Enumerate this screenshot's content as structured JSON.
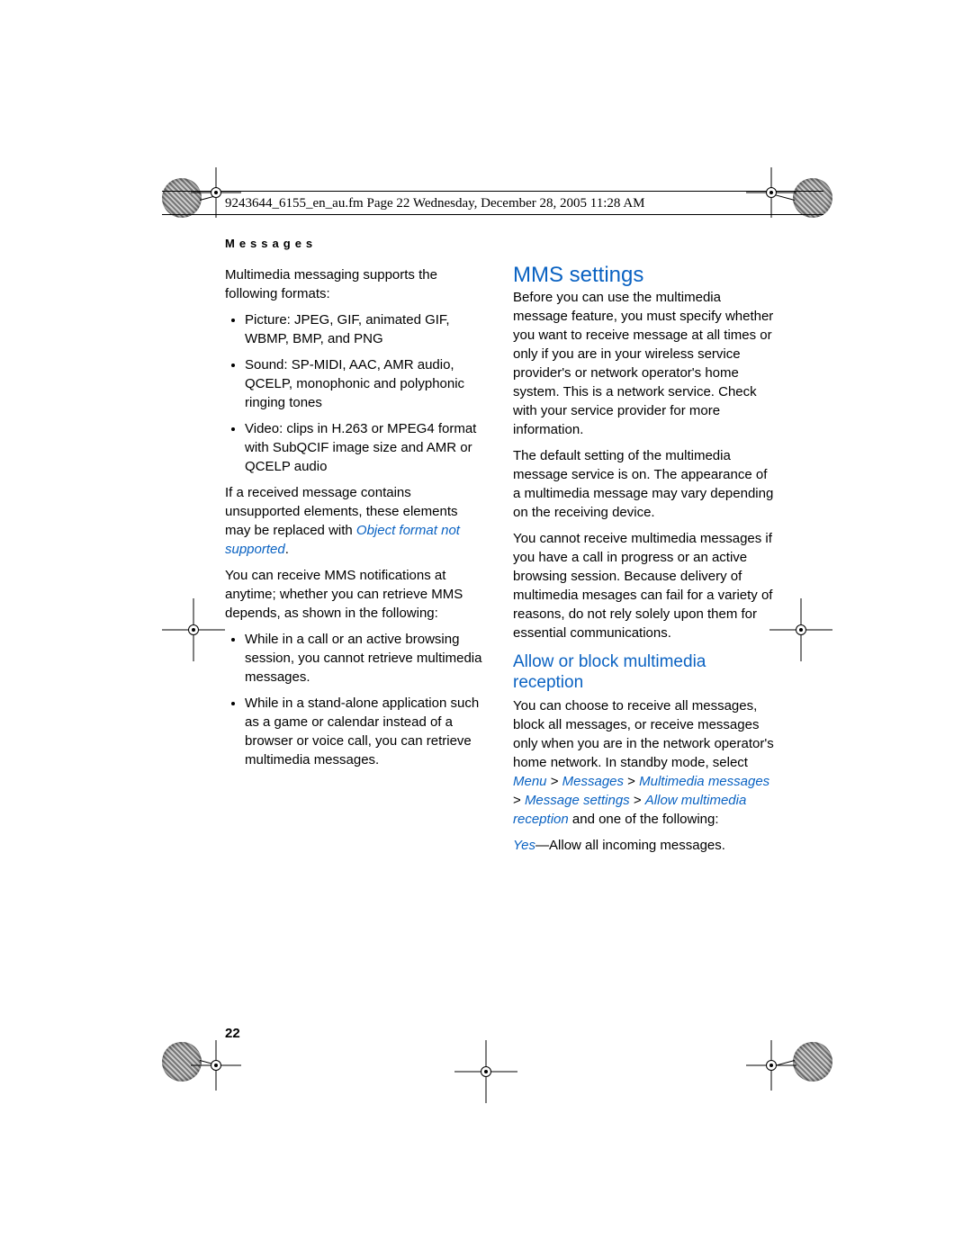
{
  "header": {
    "meta_line": "9243644_6155_en_au.fm  Page 22  Wednesday, December 28, 2005  11:28 AM"
  },
  "section_label": "Messages",
  "page_number": "22",
  "left_col": {
    "intro": "Multimedia messaging supports the following formats:",
    "bullets_1": [
      "Picture: JPEG, GIF, animated GIF, WBMP, BMP, and PNG",
      "Sound: SP-MIDI, AAC, AMR audio, QCELP, monophonic and polyphonic ringing tones",
      "Video: clips in H.263 or MPEG4 format with SubQCIF image size and AMR or QCELP audio"
    ],
    "p2_a": "If a received message contains unsupported elements, these elements may be replaced with ",
    "p2_em": "Object format not supported",
    "p2_b": ".",
    "p3": "You can receive MMS notifications at anytime; whether you can retrieve MMS depends, as shown in the following:",
    "bullets_2": [
      "While in a call or an active browsing session, you cannot retrieve multimedia messages.",
      "While in a stand-alone application such as a game or calendar instead of a browser or voice call, you can retrieve multimedia messages."
    ]
  },
  "right_col": {
    "h2": "MMS settings",
    "p1": "Before you can use the multimedia message feature, you must specify whether you want to receive message at all times or only if you are in your wireless service provider's or network operator's home system. This is a network service. Check with your service provider for more information.",
    "p2": "The default setting of the multimedia message service is on. The appearance of a multimedia message may vary depending on the receiving device.",
    "p3": "You cannot receive multimedia messages if you have a call in progress or an active browsing session. Because delivery of multimedia mesages can fail for a variety of reasons, do not rely solely upon them for essential communications.",
    "h3": "Allow or block multimedia reception",
    "p4_a": "You can choose to receive all messages, block all messages, or receive messages only when you are in the network operator's home network. In standby mode, select ",
    "p4_menu": "Menu",
    "p4_sep1": " > ",
    "p4_msgs": "Messages",
    "p4_sep2": " > ",
    "p4_mm": "Multimedia messages",
    "p4_sep3": " > ",
    "p4_ms": "Message settings",
    "p4_sep4": " > ",
    "p4_amr": "Allow multimedia reception",
    "p4_b": " and one of the following:",
    "p5_yes": "Yes",
    "p5_b": "—Allow all incoming messages."
  }
}
